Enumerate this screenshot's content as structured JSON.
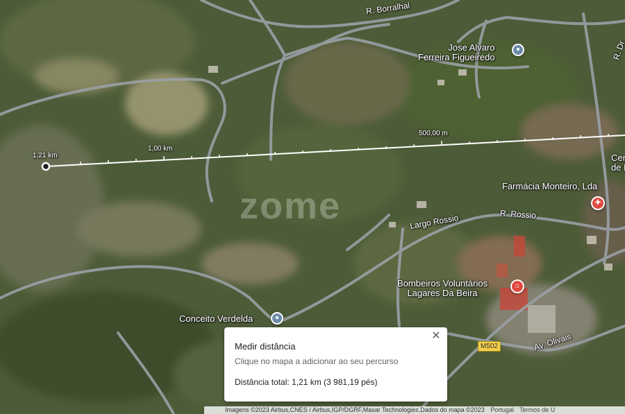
{
  "watermark": "zome",
  "places": [
    {
      "name": "Jose Alvaro",
      "name2": "Ferreira Figueiredo"
    },
    {
      "name": "Farmácia Monteiro, Lda"
    },
    {
      "name": "Bombeiros Voluntários",
      "name2": "Lagares Da Beira"
    },
    {
      "name": "Conceito Verdelda"
    },
    {
      "name": "Cer",
      "name2": "de B"
    }
  ],
  "roads": {
    "borralhal": "R. Borralhal",
    "rossio": "R. Rossio",
    "largo_rossio": "Largo Rossio",
    "olivais": "Av. Olivais",
    "dr": "R. Dr"
  },
  "road_shield": "M502",
  "ruler": {
    "start_label": "1,21 km",
    "mid_label": "1,00 km",
    "half_label": "500,00 m"
  },
  "measure_panel": {
    "title": "Medir distância",
    "hint": "Clique no mapa a adicionar ao seu percurso",
    "total": "Distância total: 1,21 km (3 981,19 pés)",
    "close": "✕"
  },
  "attribution": {
    "imagery": "Imagens ©2023 Airbus,CNES / Airbus,IGP/DGRF,Maxar Technologies,Dados do mapa ©2023",
    "language": "Portugal",
    "terms": "Termos de U"
  },
  "colors": {
    "road": "#9aa0a6",
    "measure_line": "#ffffff",
    "pin_blue": "#6e8ba8",
    "pin_red": "#e0493f",
    "shield": "#f4d04a"
  }
}
